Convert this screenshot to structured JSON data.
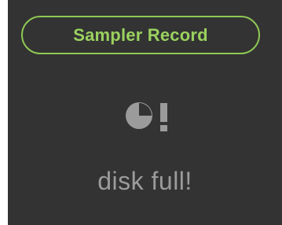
{
  "header": {
    "title": "Sampler Record"
  },
  "status": {
    "message": "disk full!",
    "icon": "disk-full-icon"
  },
  "colors": {
    "background": "#333333",
    "accent": "#8ec854",
    "title_text": "#9bd15f",
    "status_text": "#9b9b9b",
    "icon": "#9b9b9b"
  }
}
